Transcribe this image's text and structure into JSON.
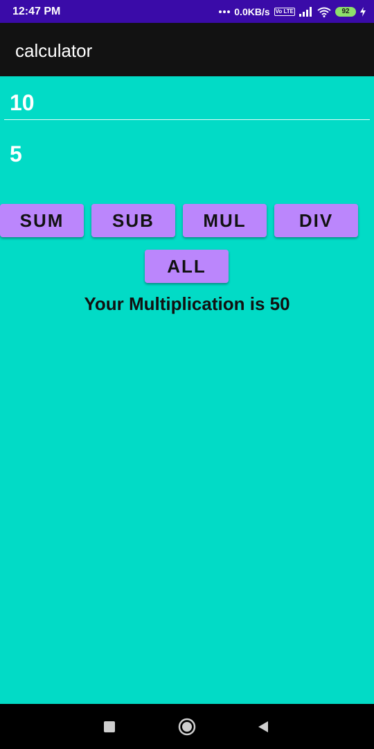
{
  "status_bar": {
    "time": "12:47 PM",
    "network_speed": "0.0KB/s",
    "volte_label": "Vo LTE",
    "battery_level": "92",
    "icons": [
      "dots-icon",
      "volte-icon",
      "signal-icon",
      "wifi-icon",
      "battery-icon",
      "charging-icon"
    ],
    "background": "#3a0ba8"
  },
  "app_bar": {
    "title": "calculator",
    "background": "#121212"
  },
  "inputs": {
    "first_number": "10",
    "second_number": "5"
  },
  "buttons": {
    "sum": "SUM",
    "sub": "SUB",
    "mul": "MUL",
    "div": "DIV",
    "all": "ALL",
    "color": "#bb86fc"
  },
  "result": {
    "text": "Your Multiplication is 50"
  },
  "nav_bar": {
    "icons": [
      "recents-icon",
      "home-icon",
      "back-icon"
    ],
    "background": "#000000"
  },
  "colors": {
    "background": "#02dbc6"
  }
}
